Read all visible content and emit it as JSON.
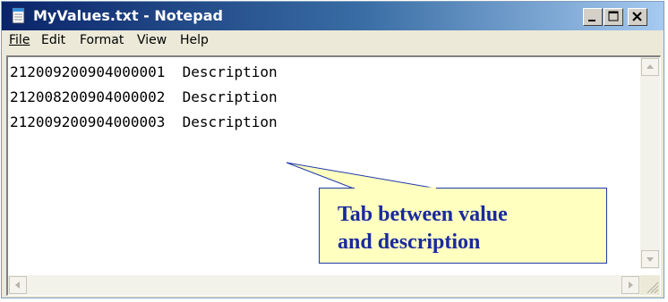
{
  "window": {
    "title": "MyValues.txt - Notepad"
  },
  "menu": {
    "items": [
      {
        "label": "File"
      },
      {
        "label": "Edit"
      },
      {
        "label": "Format"
      },
      {
        "label": "View"
      },
      {
        "label": "Help"
      }
    ]
  },
  "editor": {
    "lines": [
      {
        "value": "212009200904000001",
        "description": "Description"
      },
      {
        "value": "212008200904000002",
        "description": "Description"
      },
      {
        "value": "212009200904000003",
        "description": "Description"
      }
    ]
  },
  "callout": {
    "line1": "Tab between value",
    "line2": "and description"
  },
  "colors": {
    "title_gradient_start": "#0a246a",
    "title_gradient_end": "#a6caf0",
    "callout_background": "#ffffc0",
    "callout_text": "#1a2a9c"
  },
  "icons": {
    "app": "notepad-icon",
    "minimize": "minimize-icon",
    "maximize": "maximize-icon",
    "close": "close-icon"
  }
}
